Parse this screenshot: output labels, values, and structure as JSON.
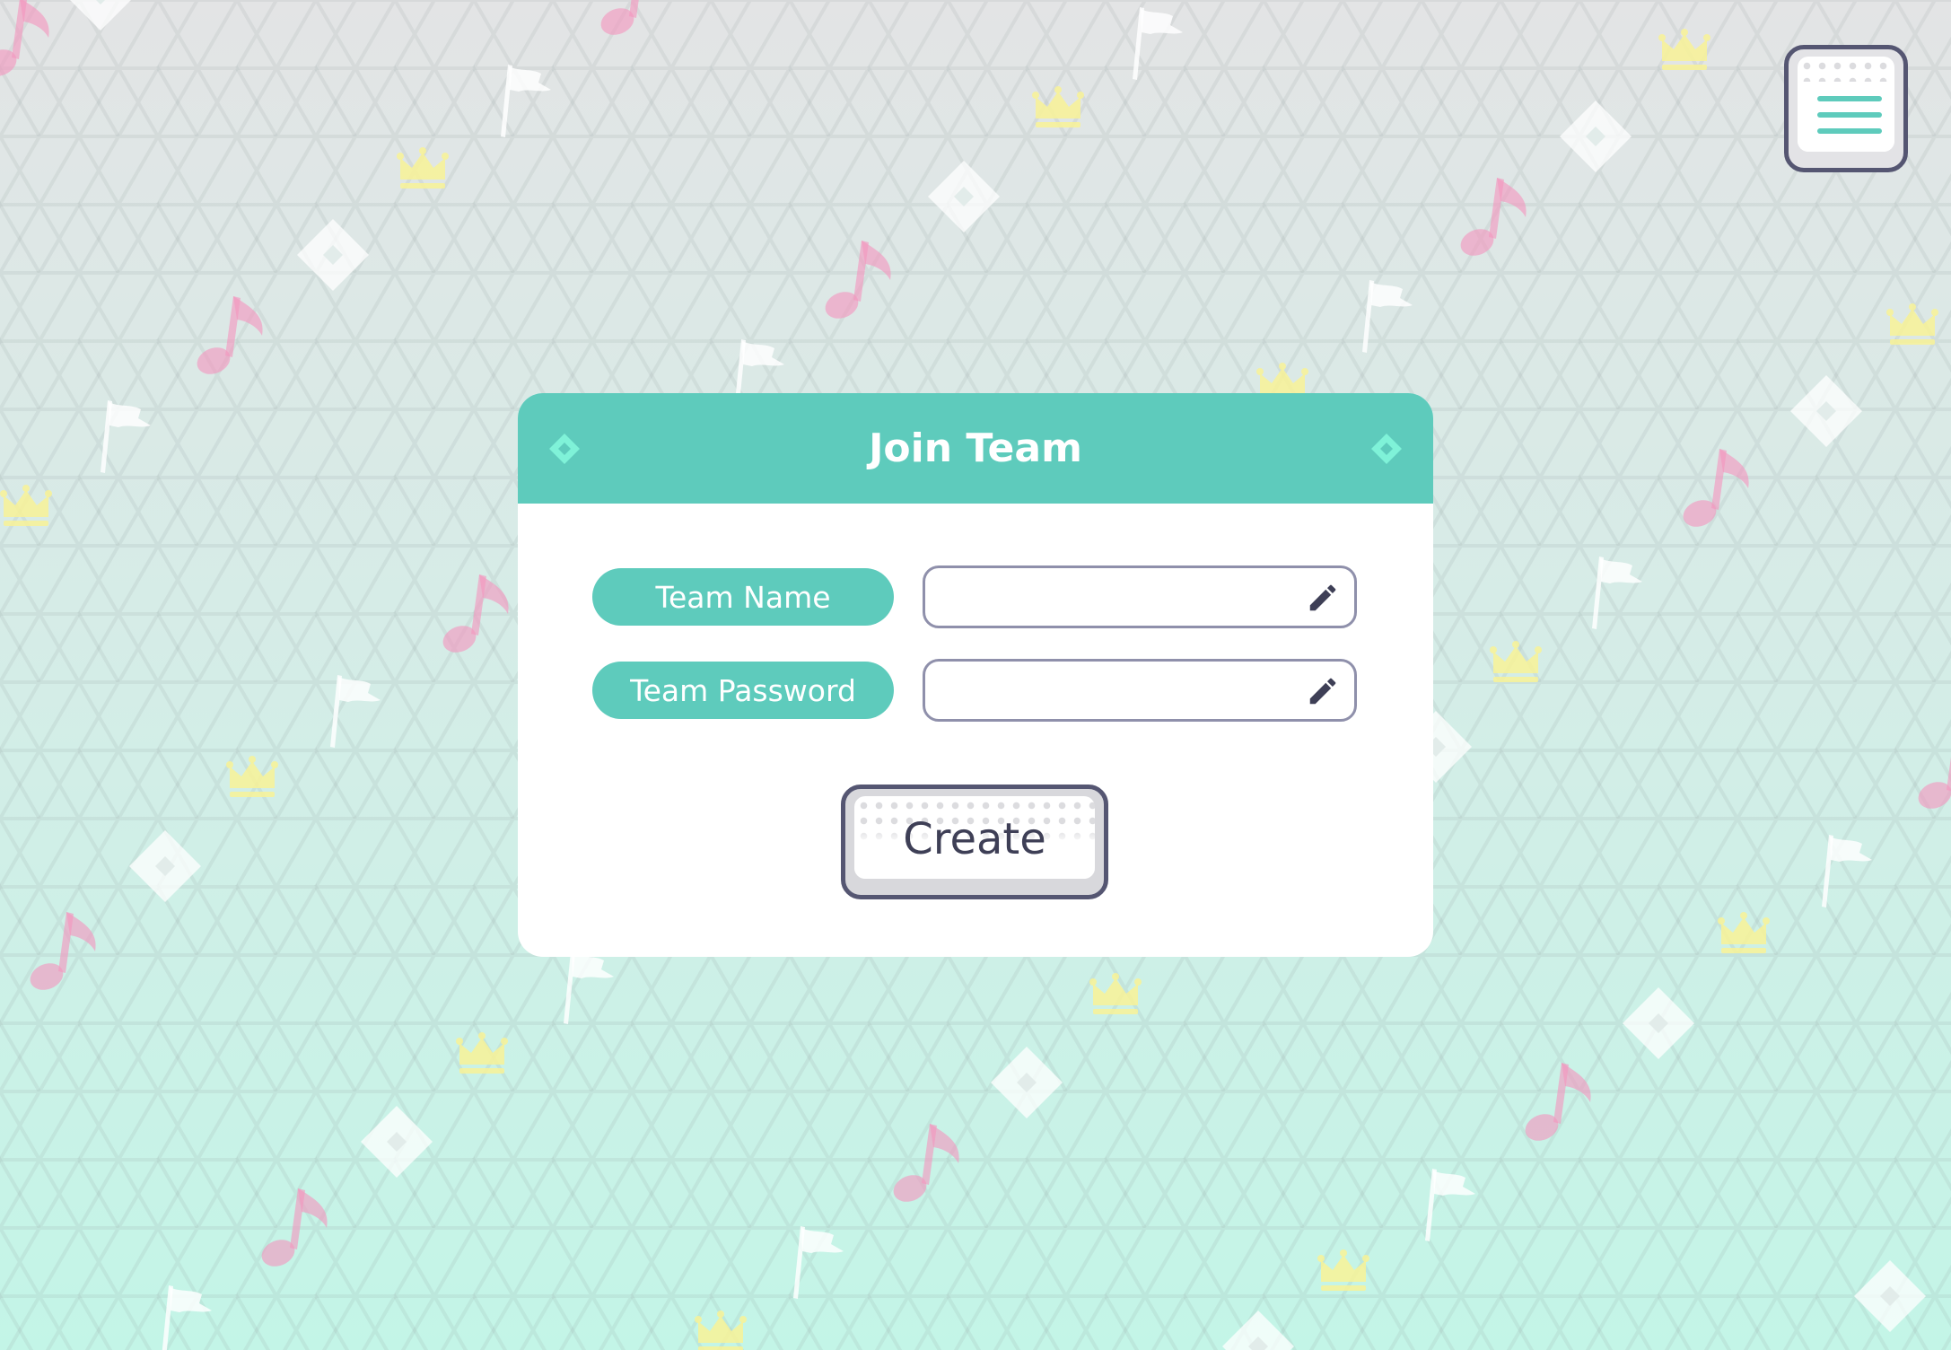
{
  "theme": {
    "accent": "#5ecbbc",
    "accent_light": "#7ff2d8",
    "dark": "#555672",
    "text_dark": "#3e3f56",
    "note_pink": "#f3aed0",
    "crown_yellow": "#f6f3a5"
  },
  "menu_button": {
    "icon": "hamburger-menu-icon"
  },
  "dialog": {
    "title": "Join Team",
    "header_icons": [
      "diamond-icon",
      "diamond-icon"
    ],
    "fields": [
      {
        "label": "Team Name",
        "value": "",
        "placeholder": "",
        "icon": "pencil-icon"
      },
      {
        "label": "Team Password",
        "value": "",
        "placeholder": "",
        "icon": "pencil-icon"
      }
    ],
    "create_label": "Create"
  },
  "background": {
    "decoration_icons": [
      "music-note-icon",
      "flag-icon",
      "crown-icon",
      "diamond-icon"
    ]
  }
}
